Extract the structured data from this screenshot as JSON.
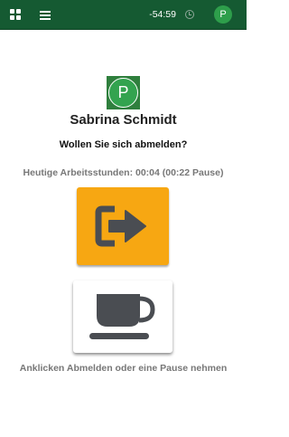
{
  "topbar": {
    "timer": "-54:59",
    "avatar_letter": "P",
    "icons": [
      "apps-grid-icon",
      "menu-icon",
      "clock-icon"
    ]
  },
  "user": {
    "avatar_letter": "P",
    "name": "Sabrina Schmidt"
  },
  "dialog": {
    "question": "Wollen Sie sich abmelden?",
    "hours_text": "Heutige Arbeitsstunden: 00:04 (00:22 Pause)",
    "hint": "Anklicken Abmelden oder eine Pause nehmen"
  },
  "buttons": {
    "logout_icon": "logout-icon",
    "pause_icon": "coffee-cup-icon"
  },
  "colors": {
    "topbar": "#155a32",
    "logout_button": "#f7a712",
    "avatar": "#2e9e4b",
    "icon_dark": "#4a4d52"
  }
}
